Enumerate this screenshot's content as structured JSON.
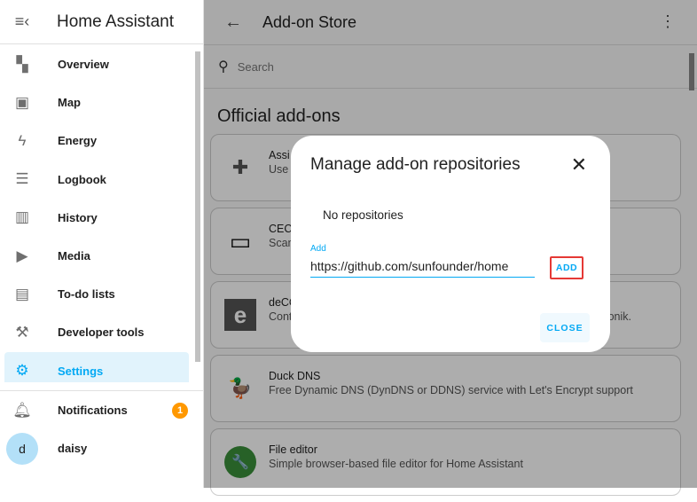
{
  "sidebar": {
    "title": "Home Assistant",
    "items": [
      {
        "label": "Overview",
        "icon": "dashboard-icon",
        "glyph": "▚"
      },
      {
        "label": "Map",
        "icon": "map-person-icon",
        "glyph": "▣"
      },
      {
        "label": "Energy",
        "icon": "lightning-icon",
        "glyph": "ϟ"
      },
      {
        "label": "Logbook",
        "icon": "list-icon",
        "glyph": "☰"
      },
      {
        "label": "History",
        "icon": "chart-icon",
        "glyph": "▥"
      },
      {
        "label": "Media",
        "icon": "play-icon",
        "glyph": "▶"
      },
      {
        "label": "To-do lists",
        "icon": "clipboard-list-icon",
        "glyph": "▤"
      },
      {
        "label": "Developer tools",
        "icon": "hammer-icon",
        "glyph": "⚒"
      },
      {
        "label": "Settings",
        "icon": "gear-icon",
        "glyph": "⚙"
      }
    ],
    "notifications": {
      "label": "Notifications",
      "count": "1"
    },
    "user": {
      "initial": "d",
      "name": "daisy"
    }
  },
  "main": {
    "title": "Add-on Store",
    "search_placeholder": "Search",
    "section": "Official add-ons",
    "cards": [
      {
        "title": "Assi",
        "desc": "Use",
        "desc_right": "",
        "glyph": "✚"
      },
      {
        "title": "CEC",
        "desc": "Scan",
        "desc_right": "",
        "glyph": "▭"
      },
      {
        "title": "deCO",
        "desc": "Cont",
        "desc_right": "onik.",
        "glyph": "e"
      },
      {
        "title": "Duck DNS",
        "desc": "Free Dynamic DNS (DynDNS or DDNS) service with Let's Encrypt support",
        "desc_right": "",
        "glyph": "🦆"
      },
      {
        "title": "File editor",
        "desc": "Simple browser-based file editor for Home Assistant",
        "desc_right": "",
        "glyph": "🔧"
      }
    ]
  },
  "dialog": {
    "title": "Manage add-on repositories",
    "empty": "No repositories",
    "field_label": "Add",
    "field_value": "https://github.com/sunfounder/home",
    "add": "ADD",
    "close": "CLOSE"
  },
  "colors": {
    "accent": "#03a9f4",
    "badge": "#ff9800",
    "highlight": "#e53935"
  }
}
